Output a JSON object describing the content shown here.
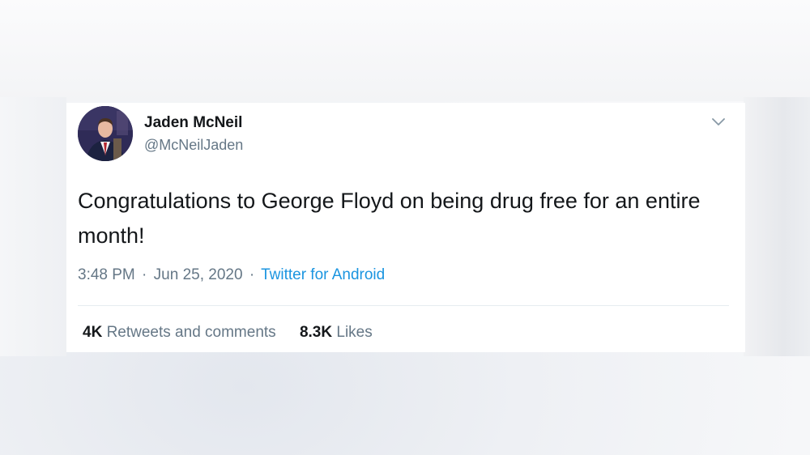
{
  "tweet": {
    "author_name": "Jaden McNeil",
    "author_handle": "@McNeilJaden",
    "text": "Congratulations to George Floyd on being drug free for an entire month!",
    "time": "3:48 PM",
    "separator": "·",
    "date": "Jun 25, 2020",
    "source": "Twitter for Android",
    "retweets_count": "4K",
    "retweets_label": "Retweets and comments",
    "likes_count": "8.3K",
    "likes_label": "Likes",
    "caret_icon": "chevron-down-icon",
    "colors": {
      "text": "#14171a",
      "secondary": "#657786",
      "link": "#1b95e0",
      "divider": "#e6ecf0"
    }
  }
}
